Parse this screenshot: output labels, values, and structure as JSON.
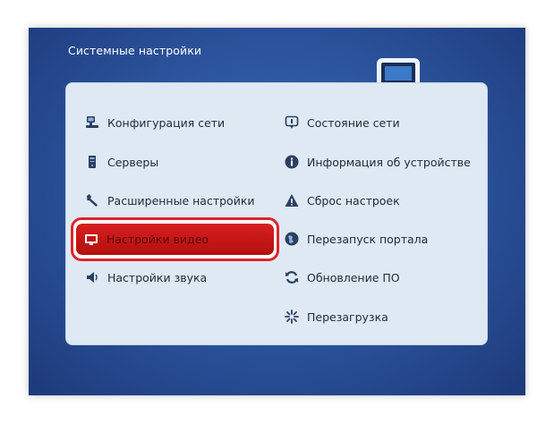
{
  "window": {
    "title": "Системные настройки"
  },
  "colors": {
    "background_blue": "#2d56a0",
    "panel": "#dfe9f4",
    "selection_red": "#c81a1a",
    "highlight_border": "#e0232a"
  },
  "menu": {
    "left": [
      {
        "label": "Конфигурация сети",
        "icon": "network-config-icon"
      },
      {
        "label": "Серверы",
        "icon": "server-icon"
      },
      {
        "label": "Расширенные настройки",
        "icon": "wrench-icon"
      },
      {
        "label": "Настройки видео",
        "icon": "monitor-icon",
        "selected": true
      },
      {
        "label": "Настройки звука",
        "icon": "speaker-icon"
      }
    ],
    "right": [
      {
        "label": "Состояние сети",
        "icon": "network-status-icon"
      },
      {
        "label": "Информация об устройстве",
        "icon": "info-icon"
      },
      {
        "label": "Сброс настроек",
        "icon": "warning-icon"
      },
      {
        "label": "Перезапуск портала",
        "icon": "globe-icon"
      },
      {
        "label": "Обновление ПО",
        "icon": "refresh-icon"
      },
      {
        "label": "Перезагрузка",
        "icon": "reboot-icon"
      }
    ]
  }
}
